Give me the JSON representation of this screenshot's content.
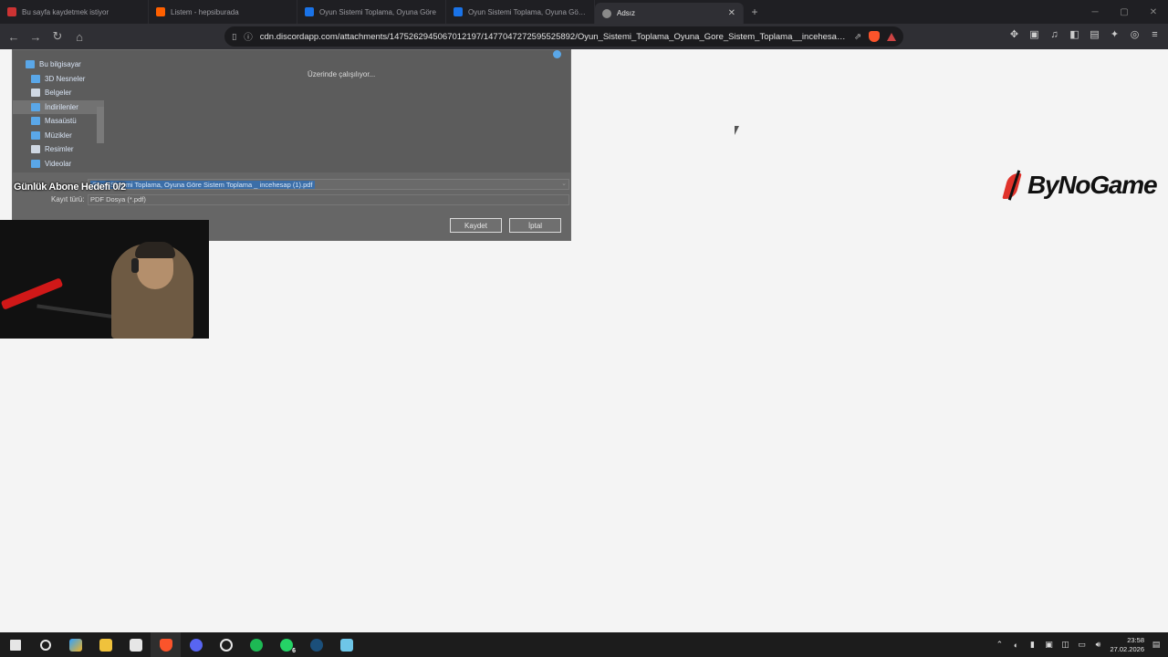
{
  "browser": {
    "tabs": [
      {
        "title": "Bu sayfa kaydetmek istiyor",
        "favicon_color": "#cc3333",
        "active": false
      },
      {
        "title": "Listem - hepsiburada",
        "favicon_color": "#ff6000",
        "active": false
      },
      {
        "title": "Oyun Sistemi Toplama, Oyuna Göre",
        "favicon_color": "#1a73e8",
        "active": false
      },
      {
        "title": "Oyun Sistemi Toplama, Oyuna Göre S",
        "favicon_color": "#1a73e8",
        "active": false
      },
      {
        "title": "Adsız",
        "favicon_color": "#8a8a8a",
        "active": true
      }
    ],
    "address": "cdn.discordapp.com/attachments/1475262945067012197/1477047272595525892/Oyun_Sistemi_Toplama_Oyuna_Gore_Sistem_Toplama__incehesap...",
    "accent": "#fb542b"
  },
  "dialog": {
    "sidebar_items": [
      {
        "label": "Bu bilgisayar",
        "icon": "computer-icon"
      },
      {
        "label": "3D Nesneler",
        "icon": "cube-icon"
      },
      {
        "label": "Belgeler",
        "icon": "document-icon"
      },
      {
        "label": "İndirilenler",
        "icon": "download-icon"
      },
      {
        "label": "Masaüstü",
        "icon": "desktop-icon"
      },
      {
        "label": "Müzikler",
        "icon": "music-icon"
      },
      {
        "label": "Resimler",
        "icon": "pictures-icon"
      },
      {
        "label": "Videolar",
        "icon": "video-icon"
      }
    ],
    "status": "Üzerinde çalışılıyor...",
    "filename": "Oyun Sistemi Toplama, Oyuna Göre Sistem Toplama _ incehesap (1).pdf",
    "type_label": "Kayıt türü:",
    "type_value": "PDF Dosya (*.pdf)",
    "save_label": "Kaydet",
    "cancel_label": "İptal"
  },
  "overlay": {
    "goal_text": "Günlük Abone Hedefi 0/2"
  },
  "page": {
    "logo_text": "ByNoGame",
    "logo_color": "#e0332b"
  },
  "taskbar": {
    "apps": [
      "start-icon",
      "search-icon",
      "copilot-icon",
      "file-explorer-icon",
      "store-icon",
      "brave-icon",
      "discord-icon",
      "app-icon",
      "spotify-icon",
      "whatsapp-icon",
      "steam-icon",
      "notepad-icon"
    ],
    "whatsapp_badge": "6",
    "time": "23:58",
    "date": "27.02.2026"
  }
}
